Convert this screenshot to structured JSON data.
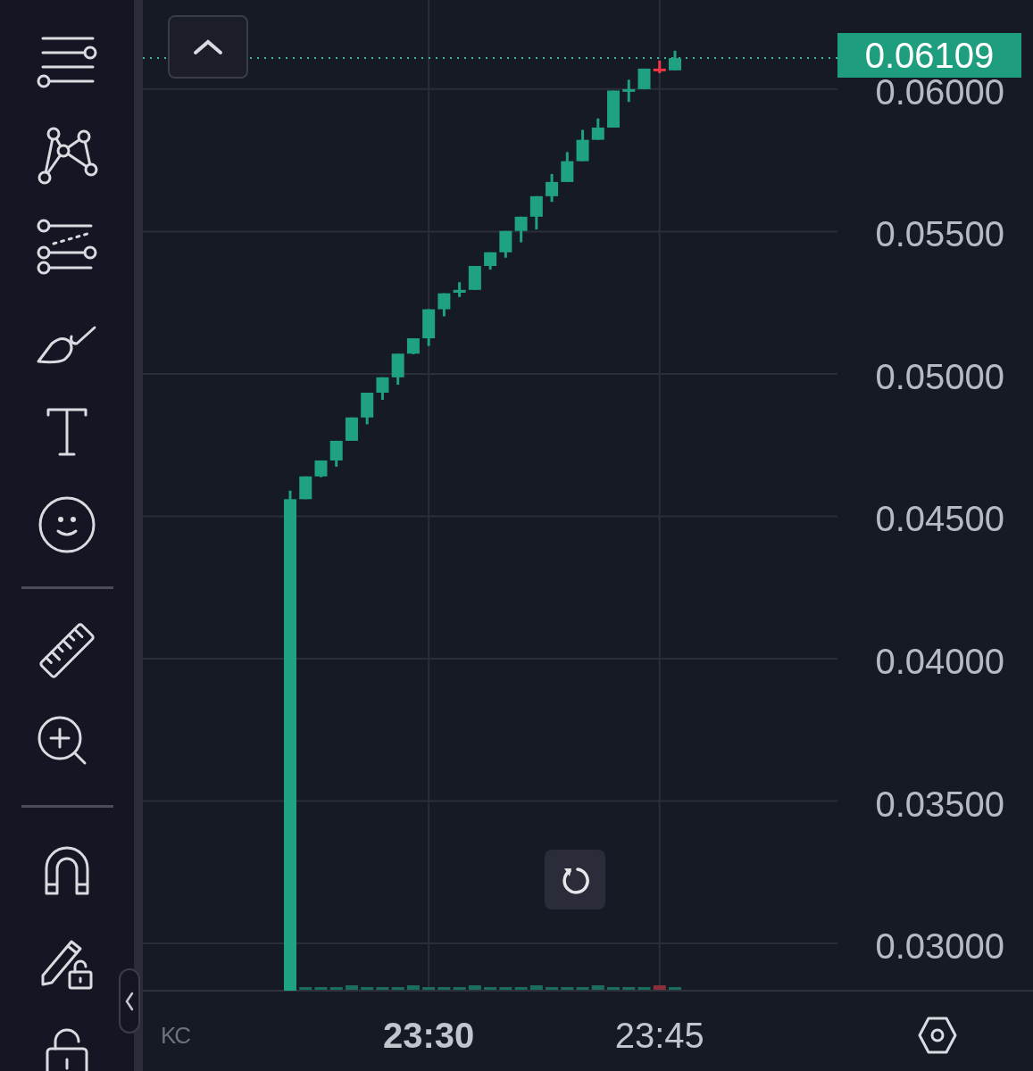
{
  "chart": {
    "current_price": "0.06109",
    "logo": "KC",
    "price_axis_labels": [
      "0.06000",
      "0.05500",
      "0.05000",
      "0.04500",
      "0.04000",
      "0.03500",
      "0.03000"
    ],
    "time_axis_labels": [
      {
        "label": "23:30",
        "emphasized": true
      },
      {
        "label": "23:45",
        "emphasized": false
      }
    ]
  }
}
